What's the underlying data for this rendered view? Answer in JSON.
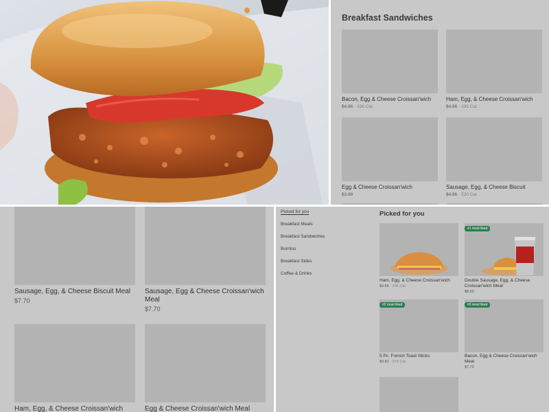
{
  "top_right": {
    "section_title": "Breakfast Sandwiches",
    "items": [
      {
        "name": "Bacon, Egg & Cheese Croissan'wich",
        "price": "$4.86",
        "sep": " · ",
        "cal": "336 Cal."
      },
      {
        "name": "Ham, Egg, & Cheese Croissan'wich",
        "price": "$4.86",
        "sep": " · ",
        "cal": "335 Cal."
      },
      {
        "name": "Egg & Cheese Croissan'wich",
        "price": "$3.69",
        "sep": "",
        "cal": ""
      },
      {
        "name": "Sausage, Egg, & Cheese Biscuit",
        "price": "$4.86",
        "sep": " · ",
        "cal": "520 Cal."
      }
    ]
  },
  "bottom_left": {
    "items": [
      {
        "name": "Sausage, Egg, & Cheese Biscuit Meal",
        "price": "$7.70"
      },
      {
        "name": "Sausage, Egg & Cheese Croissan'wich Meal",
        "price": "$7.70"
      },
      {
        "name": "Ham, Egg, & Cheese Croissan'wich",
        "price": ""
      },
      {
        "name": "Egg & Cheese Croissan'wich Meal",
        "price": ""
      }
    ]
  },
  "bottom_right": {
    "nav": [
      "Picked for you",
      "Breakfast Meals",
      "Breakfast Sandwiches",
      "Burritos",
      "Breakfast Sides",
      "Coffee & Drinks"
    ],
    "section_title": "Picked for you",
    "items": [
      {
        "badge": "",
        "name": "Ham, Egg, & Cheese Croissan'wich",
        "price": "$4.86",
        "sep": " · ",
        "cal": "335 Cal."
      },
      {
        "badge": "#1 most liked",
        "name": "Double Sausage, Egg, & Cheese Croissan'wich Meal",
        "price": "$8.69",
        "sep": "",
        "cal": ""
      },
      {
        "badge": "#2 most liked",
        "name": "5 Pc. French Toast Sticks",
        "price": "$3.82",
        "sep": " · ",
        "cal": "379 Cal."
      },
      {
        "badge": "#3 most liked",
        "name": "Bacon, Egg & Cheese Croissan'wich Meal",
        "price": "$7.70",
        "sep": "",
        "cal": ""
      }
    ]
  },
  "colors": {
    "panel_bg": "#c8c8c8",
    "placeholder": "#b3b3b3",
    "badge": "#2e7d4f",
    "bun": "#d9933f",
    "tomato": "#d8382c",
    "lettuce": "#9ccf4a",
    "patty": "#b5521f"
  },
  "icons": {
    "photo": "chicken-sandwich-photo",
    "meal_thumbnail": "croissanwich-photo",
    "drink": "coca-cola-cup-photo"
  }
}
